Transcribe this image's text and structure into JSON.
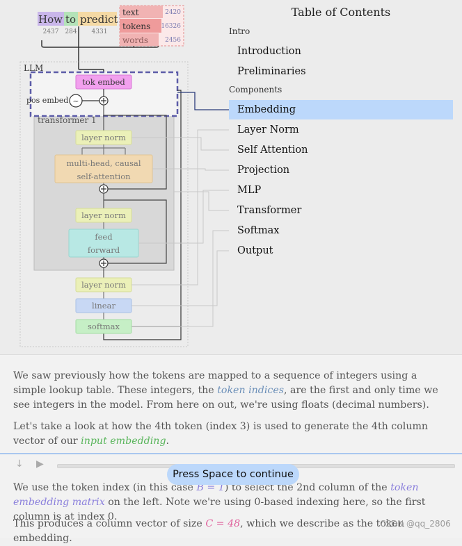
{
  "diagram": {
    "tokens": [
      {
        "word": "How",
        "index": "2437"
      },
      {
        "word": "to",
        "index": "284"
      },
      {
        "word": "predict",
        "index": "4331"
      }
    ],
    "legend": [
      {
        "label": "text",
        "count": "2420"
      },
      {
        "label": "tokens",
        "count": "16326"
      },
      {
        "label": "words",
        "count": "2456"
      }
    ],
    "llm_label": "LLM",
    "tok_embed": "tok embed",
    "pos_embed": "pos embed",
    "transformer_label": "transformer 1",
    "layer_norm": "layer norm",
    "attention_1": "multi-head, causal",
    "attention_2": "self-attention",
    "ff_1": "feed",
    "ff_2": "forward",
    "linear": "linear",
    "softmax": "softmax"
  },
  "toc": {
    "title": "Table of Contents",
    "sections": [
      {
        "name": "Intro",
        "items": [
          "Introduction",
          "Preliminaries"
        ]
      },
      {
        "name": "Components",
        "items": [
          "Embedding",
          "Layer Norm",
          "Self Attention",
          "Projection",
          "MLP",
          "Transformer",
          "Softmax",
          "Output"
        ]
      }
    ],
    "active": "Embedding"
  },
  "text": {
    "p1": {
      "a": "We saw previously how the tokens are mapped to a sequence of integers using a simple lookup table. These integers, the ",
      "b": "token indices",
      "c": ", are the first and only time we see integers in the model. From here on out, we're using floats (decimal numbers)."
    },
    "p2": {
      "a": "Let's take a look at how the 4th token (index 3) is used to generate the 4th column vector of our ",
      "b": "input embedding",
      "c": "."
    },
    "p3": {
      "a": "We use the token index (in this case ",
      "b": "B = 1",
      "c": ") to select the 2nd column of the ",
      "d": "token embedding matrix",
      "e": " on the left. Note we're using 0-based indexing here, so the first column is at index 0."
    },
    "p4": {
      "a": "This produces a column vector of size ",
      "b": "C = 48",
      "c": ", which we describe as the token embedding."
    }
  },
  "controls": {
    "down_icon": "↓",
    "play_icon": "▶",
    "continue_label": "Press Space to continue"
  },
  "watermark": "CSDN @qq_2806"
}
